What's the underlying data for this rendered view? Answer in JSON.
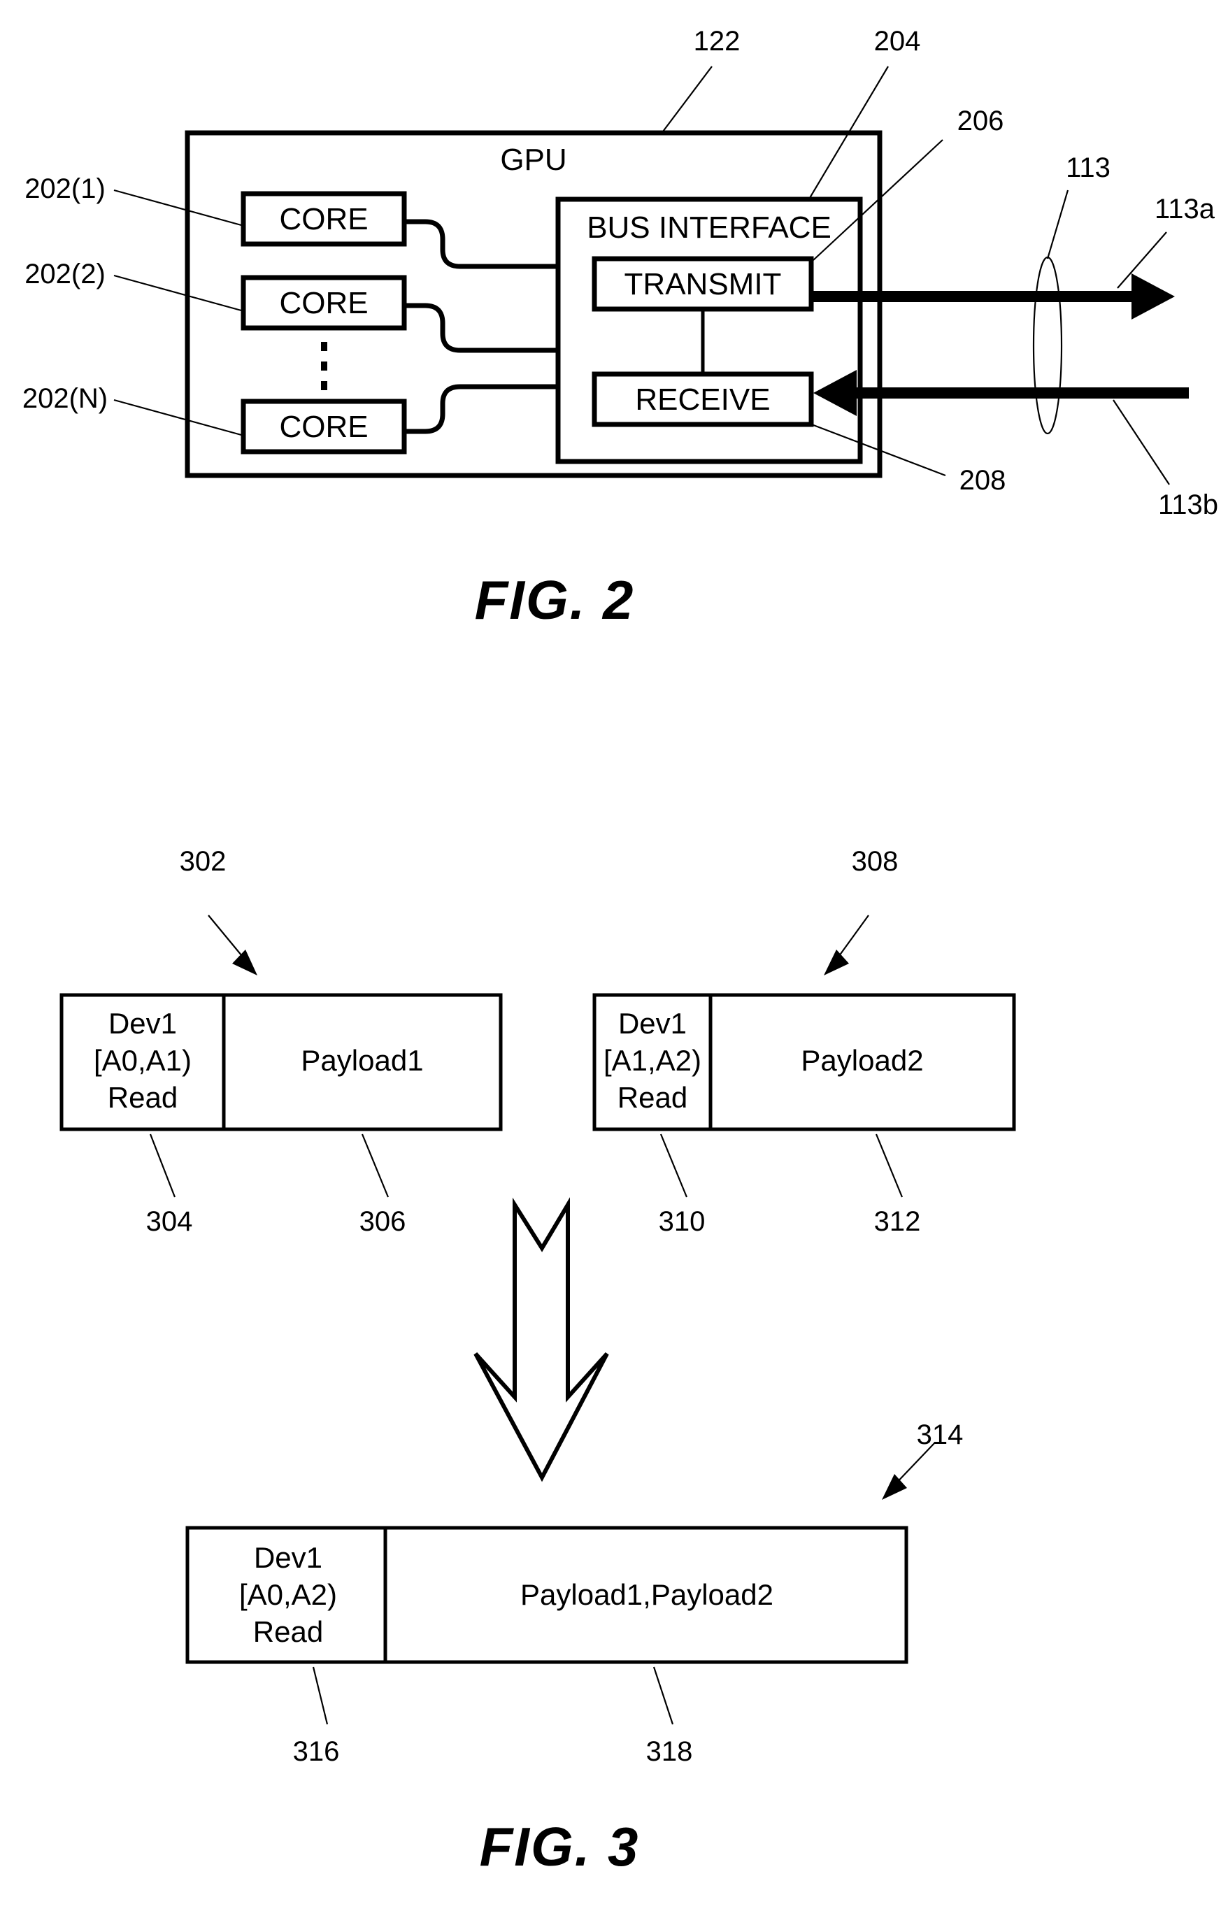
{
  "figures": [
    {
      "id": "fig2",
      "caption": "FIG. 2",
      "gpu_block": {
        "title": "GPU",
        "ref": "122",
        "cores": [
          {
            "label": "CORE",
            "ref": "202(1)"
          },
          {
            "label": "CORE",
            "ref": "202(2)"
          },
          {
            "label": "CORE",
            "ref": "202(N)"
          }
        ],
        "vertical_ellipsis": "⋮",
        "bus_interface": {
          "title": "BUS INTERFACE",
          "ref": "204",
          "transmit": {
            "label": "TRANSMIT",
            "ref": "206"
          },
          "receive": {
            "label": "RECEIVE",
            "ref": "208"
          }
        }
      },
      "bus": {
        "ref": "113",
        "outbound_ref": "113a",
        "inbound_ref": "113b"
      }
    },
    {
      "id": "fig3",
      "caption": "FIG. 3",
      "input_packets": [
        {
          "ref": "302",
          "header": {
            "line1": "Dev1",
            "line2": "[A0,A1)",
            "line3": "Read",
            "ref": "304"
          },
          "payload": {
            "label": "Payload1",
            "ref": "306"
          }
        },
        {
          "ref": "308",
          "header": {
            "line1": "Dev1",
            "line2": "[A1,A2)",
            "line3": "Read",
            "ref": "310"
          },
          "payload": {
            "label": "Payload2",
            "ref": "312"
          }
        }
      ],
      "merge_arrow": "down-arrow",
      "output_packet": {
        "ref": "314",
        "header": {
          "line1": "Dev1",
          "line2": "[A0,A2)",
          "line3": "Read",
          "ref": "316"
        },
        "payload": {
          "label": "Payload1,Payload2",
          "ref": "318"
        }
      }
    }
  ]
}
